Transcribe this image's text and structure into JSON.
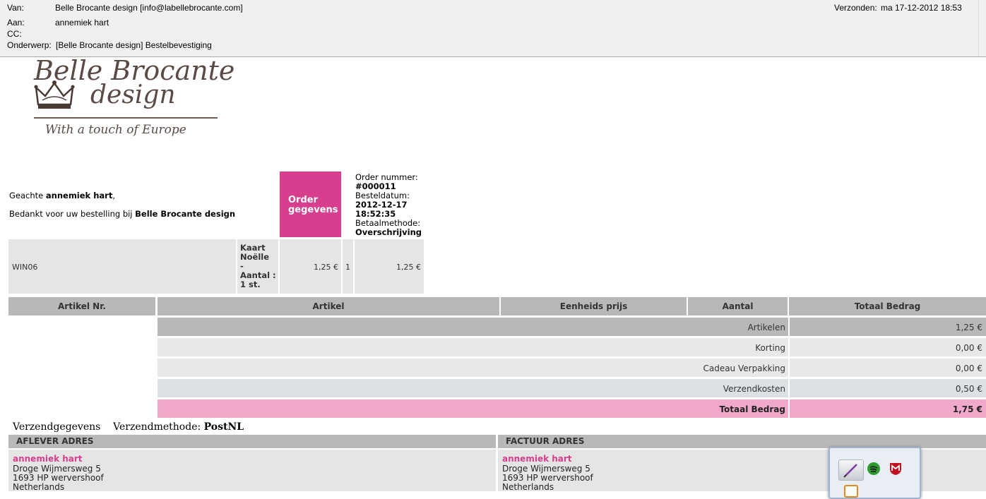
{
  "email": {
    "from_label": "Van:",
    "from": "Belle Brocante design [info@labellebrocante.com]",
    "to_label": "Aan:",
    "to": "annemiek hart",
    "cc_label": "CC:",
    "subject_label": "Onderwerp:",
    "subject": "[Belle Brocante design] Bestelbevestiging",
    "sent_label": "Verzonden:",
    "sent": "ma 17-12-2012 18:53"
  },
  "logo": {
    "line1": "Belle Brocante",
    "line2": "design",
    "tagline": "With a touch of Europe"
  },
  "greeting": {
    "prefix": "Geachte ",
    "name": "annemiek hart",
    "suffix": ",",
    "thanks_prefix": "Bedankt voor uw bestelling bij ",
    "shop": "Belle Brocante design"
  },
  "order": {
    "badge_line1": "Order",
    "badge_line2": "gegevens",
    "number_label": "Order nummer:",
    "number": "#000011",
    "date_label": "Besteldatum:",
    "date": "2012-12-17",
    "time": "18:52:35",
    "payment_label": "Betaalmethode:",
    "payment": "Overschrijving"
  },
  "item": {
    "code": "WIN06",
    "name_l1": "Kaart",
    "name_l2": "Noëlle",
    "name_l3": "-",
    "name_l4": "Aantal :",
    "name_l5": "1 st.",
    "unit_price": "1,25 €",
    "qty": "1",
    "total": "1,25 €"
  },
  "table_headers": {
    "code": "Artikel Nr.",
    "article": "Artikel",
    "unit_price": "Eenheids prijs",
    "qty": "Aantal",
    "total": "Totaal Bedrag"
  },
  "totals": [
    {
      "label": "Artikelen",
      "value": "1,25 €"
    },
    {
      "label": "Korting",
      "value": "0,00 €"
    },
    {
      "label": "Cadeau Verpakking",
      "value": "0,00 €"
    },
    {
      "label": "Verzendkosten",
      "value": "0,50 €"
    },
    {
      "label": "Totaal Bedrag",
      "value": "1,75 €"
    }
  ],
  "shipping": {
    "title": "Verzendgegevens",
    "method_label": "Verzendmethode:",
    "method": "PostNL"
  },
  "delivery_address": {
    "header": "AFLEVER ADRES",
    "name": "annemiek hart",
    "street": "Droge Wijmersweg 5",
    "city": "1693 HP wervershoof",
    "country": "Netherlands"
  },
  "invoice_address": {
    "header": "FACTUUR ADRES",
    "name": "annemiek hart",
    "street": "Droge Wijmersweg 5",
    "city": "1693 HP wervershoof",
    "country": "Netherlands"
  },
  "tray_icons": [
    "pen-tool-icon",
    "spotify-icon",
    "mcafee-icon",
    "rss-icon"
  ],
  "colors": {
    "accent": "#d73e8e",
    "total_row": "#f0a8cb",
    "header_gray": "#b8b8b8"
  }
}
